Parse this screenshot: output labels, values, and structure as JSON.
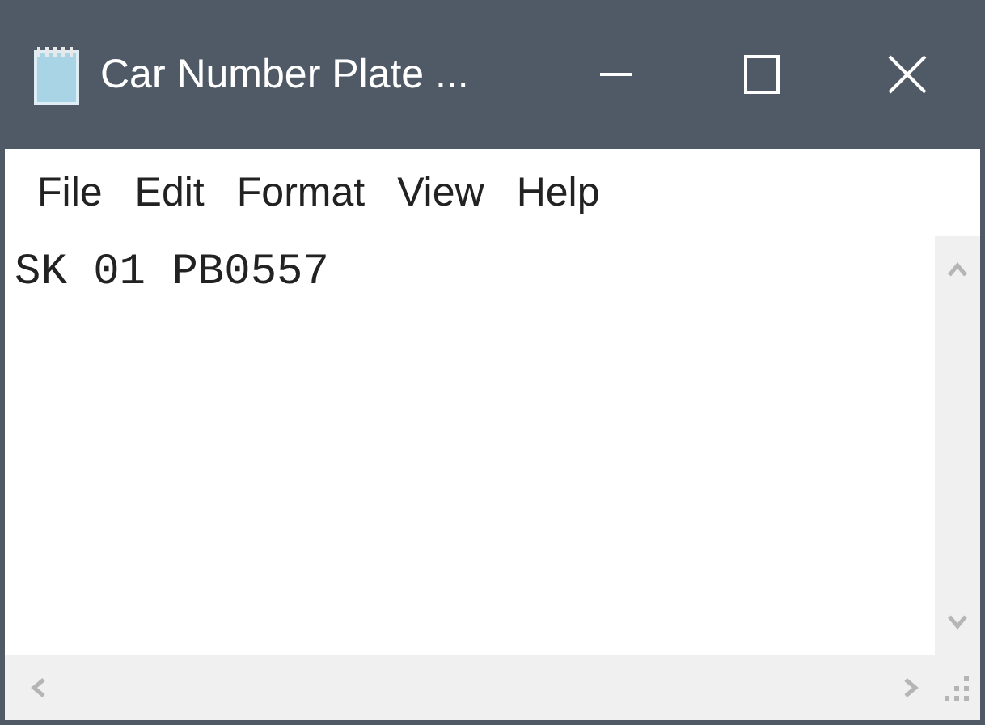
{
  "window": {
    "title": "Car Number Plate ..."
  },
  "menu": [
    "File",
    "Edit",
    "Format",
    "View",
    "Help"
  ],
  "editor": {
    "value": "SK 01 PB0557"
  }
}
